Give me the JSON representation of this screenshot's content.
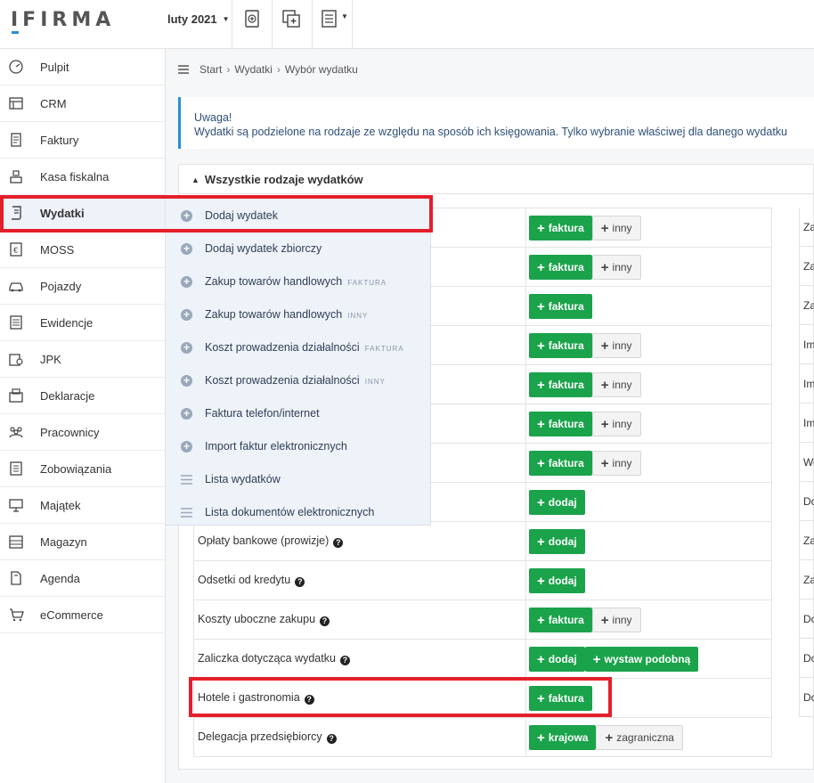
{
  "app": {
    "logo": "IFIRMA"
  },
  "topbar": {
    "period_label": "luty 2021",
    "icons": [
      "add-document-icon",
      "add-copy-icon",
      "document-list-icon"
    ]
  },
  "sidebar": {
    "items": [
      {
        "label": "Pulpit",
        "icon": "dashboard-icon"
      },
      {
        "label": "CRM",
        "icon": "crm-icon"
      },
      {
        "label": "Faktury",
        "icon": "invoice-icon"
      },
      {
        "label": "Kasa fiskalna",
        "icon": "cash-register-icon"
      },
      {
        "label": "Wydatki",
        "icon": "expenses-icon",
        "active": true
      },
      {
        "label": "MOSS",
        "icon": "euro-icon"
      },
      {
        "label": "Pojazdy",
        "icon": "car-icon"
      },
      {
        "label": "Ewidencje",
        "icon": "records-icon"
      },
      {
        "label": "JPK",
        "icon": "jpk-icon"
      },
      {
        "label": "Deklaracje",
        "icon": "declarations-icon"
      },
      {
        "label": "Pracownicy",
        "icon": "employees-icon"
      },
      {
        "label": "Zobowiązania",
        "icon": "obligations-icon"
      },
      {
        "label": "Majątek",
        "icon": "assets-icon"
      },
      {
        "label": "Magazyn",
        "icon": "warehouse-icon"
      },
      {
        "label": "Agenda",
        "icon": "agenda-icon"
      },
      {
        "label": "eCommerce",
        "icon": "cart-icon"
      }
    ]
  },
  "breadcrumb": {
    "items": [
      "Start",
      "Wydatki",
      "Wybór wydatku"
    ]
  },
  "alert": {
    "title": "Uwaga!",
    "text": "Wydatki są podzielone na rodzaje ze względu na sposób ich księgowania. Tylko wybranie właściwej dla danego wydatku"
  },
  "panel": {
    "title": "Wszystkie rodzaje wydatków"
  },
  "dropdown": {
    "items": [
      {
        "label": "Dodaj wydatek",
        "tag": "",
        "icon": "plus-circle-icon"
      },
      {
        "label": "Dodaj wydatek zbiorczy",
        "tag": "",
        "icon": "plus-circle-icon"
      },
      {
        "label": "Zakup towarów handlowych",
        "tag": "FAKTURA",
        "icon": "plus-circle-icon"
      },
      {
        "label": "Zakup towarów handlowych",
        "tag": "INNY",
        "icon": "plus-circle-icon"
      },
      {
        "label": "Koszt prowadzenia działalności",
        "tag": "FAKTURA",
        "icon": "plus-circle-icon"
      },
      {
        "label": "Koszt prowadzenia działalności",
        "tag": "INNY",
        "icon": "plus-circle-icon"
      },
      {
        "label": "Faktura telefon/internet",
        "tag": "",
        "icon": "plus-circle-icon"
      },
      {
        "label": "Import faktur elektronicznych",
        "tag": "",
        "icon": "plus-circle-icon"
      },
      {
        "label": "Lista wydatków",
        "tag": "",
        "icon": "list-icon"
      },
      {
        "label": "Lista dokumentów elektronicznych",
        "tag": "",
        "icon": "list-icon"
      }
    ]
  },
  "expense_rows": [
    {
      "name": "",
      "buttons": [
        {
          "label": "faktura",
          "style": "green"
        },
        {
          "label": "inny",
          "style": "grey"
        }
      ]
    },
    {
      "name": "",
      "buttons": [
        {
          "label": "faktura",
          "style": "green"
        },
        {
          "label": "inny",
          "style": "grey"
        }
      ]
    },
    {
      "name": "",
      "buttons": [
        {
          "label": "faktura",
          "style": "green"
        }
      ]
    },
    {
      "name": "",
      "buttons": [
        {
          "label": "faktura",
          "style": "green"
        },
        {
          "label": "inny",
          "style": "grey"
        }
      ]
    },
    {
      "name": "",
      "buttons": [
        {
          "label": "faktura",
          "style": "green"
        },
        {
          "label": "inny",
          "style": "grey"
        }
      ]
    },
    {
      "name": "",
      "buttons": [
        {
          "label": "faktura",
          "style": "green"
        },
        {
          "label": "inny",
          "style": "grey"
        }
      ]
    },
    {
      "name": "",
      "buttons": [
        {
          "label": "faktura",
          "style": "green"
        },
        {
          "label": "inny",
          "style": "grey"
        }
      ]
    },
    {
      "name": "",
      "buttons": [
        {
          "label": "dodaj",
          "style": "green"
        }
      ]
    },
    {
      "name": "Opłaty bankowe (prowizje)",
      "buttons": [
        {
          "label": "dodaj",
          "style": "green"
        }
      ]
    },
    {
      "name": "Odsetki od kredytu",
      "buttons": [
        {
          "label": "dodaj",
          "style": "green"
        }
      ]
    },
    {
      "name": "Koszty uboczne zakupu",
      "buttons": [
        {
          "label": "faktura",
          "style": "green"
        },
        {
          "label": "inny",
          "style": "grey"
        }
      ]
    },
    {
      "name": "Zaliczka dotycząca wydatku",
      "buttons": [
        {
          "label": "dodaj",
          "style": "green"
        },
        {
          "label": "wystaw podobną",
          "style": "green"
        }
      ]
    },
    {
      "name": "Hotele i gastronomia",
      "buttons": [
        {
          "label": "faktura",
          "style": "green"
        }
      ]
    },
    {
      "name": "Delegacja przedsiębiorcy",
      "buttons": [
        {
          "label": "krajowa",
          "style": "green"
        },
        {
          "label": "zagraniczna",
          "style": "grey"
        }
      ]
    }
  ],
  "right_column_truncated": [
    "Za",
    "Za",
    "Za",
    "Im",
    "Im",
    "Im",
    "We",
    "Do",
    "Za",
    "Za",
    "Do",
    "Do",
    "Do"
  ],
  "colors": {
    "accent_blue": "#2a8fd6",
    "green_button": "#1aa34a",
    "highlight_red": "#e41f2b",
    "dropdown_bg": "#eef2f9"
  }
}
